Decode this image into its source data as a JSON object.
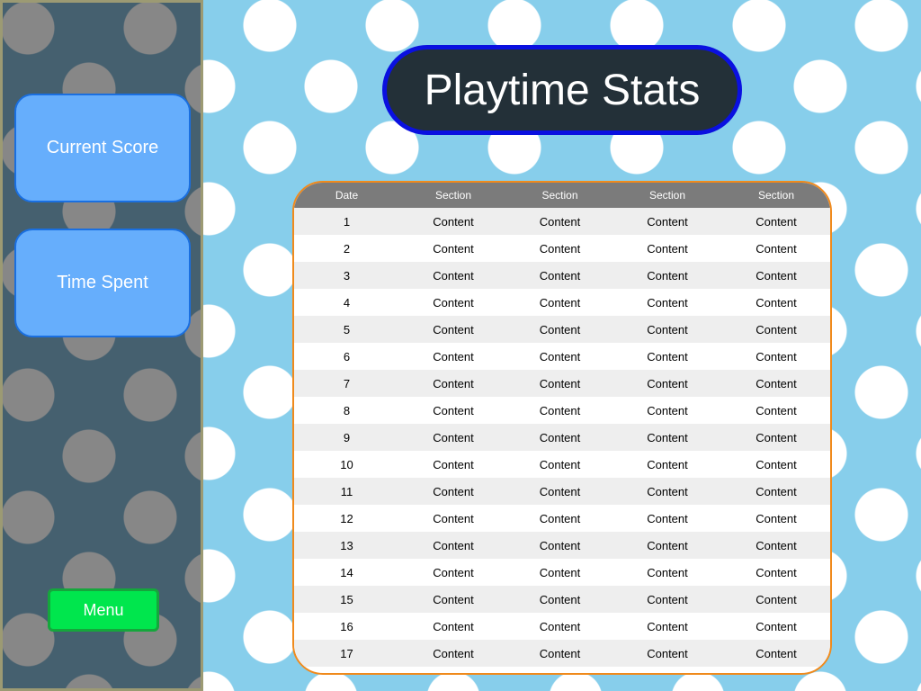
{
  "sidebar": {
    "current_score_label": "Current Score",
    "time_spent_label": "Time Spent",
    "menu_label": "Menu"
  },
  "title": "Playtime Stats",
  "table": {
    "headers": [
      "Date",
      "Section",
      "Section",
      "Section",
      "Section"
    ],
    "rows": [
      [
        "1",
        "Content",
        "Content",
        "Content",
        "Content"
      ],
      [
        "2",
        "Content",
        "Content",
        "Content",
        "Content"
      ],
      [
        "3",
        "Content",
        "Content",
        "Content",
        "Content"
      ],
      [
        "4",
        "Content",
        "Content",
        "Content",
        "Content"
      ],
      [
        "5",
        "Content",
        "Content",
        "Content",
        "Content"
      ],
      [
        "6",
        "Content",
        "Content",
        "Content",
        "Content"
      ],
      [
        "7",
        "Content",
        "Content",
        "Content",
        "Content"
      ],
      [
        "8",
        "Content",
        "Content",
        "Content",
        "Content"
      ],
      [
        "9",
        "Content",
        "Content",
        "Content",
        "Content"
      ],
      [
        "10",
        "Content",
        "Content",
        "Content",
        "Content"
      ],
      [
        "11",
        "Content",
        "Content",
        "Content",
        "Content"
      ],
      [
        "12",
        "Content",
        "Content",
        "Content",
        "Content"
      ],
      [
        "13",
        "Content",
        "Content",
        "Content",
        "Content"
      ],
      [
        "14",
        "Content",
        "Content",
        "Content",
        "Content"
      ],
      [
        "15",
        "Content",
        "Content",
        "Content",
        "Content"
      ],
      [
        "16",
        "Content",
        "Content",
        "Content",
        "Content"
      ],
      [
        "17",
        "Content",
        "Content",
        "Content",
        "Content"
      ]
    ]
  },
  "colors": {
    "background": "#87CEEB",
    "sidebar": "#45606F",
    "side_button": "#66AEFC",
    "menu_button": "#00E64D",
    "title_border": "#0A10E0",
    "table_border": "#F08A1C",
    "table_header": "#7B7B7B"
  }
}
